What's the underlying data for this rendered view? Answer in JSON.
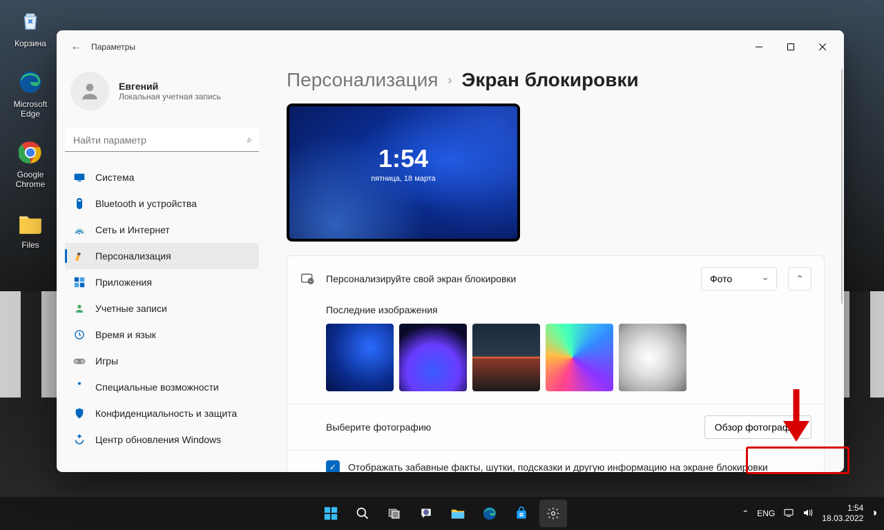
{
  "desktop_icons": [
    {
      "label": "Корзина"
    },
    {
      "label": "Microsoft Edge"
    },
    {
      "label": "Google Chrome"
    },
    {
      "label": "Files"
    }
  ],
  "window": {
    "title": "Параметры",
    "user": {
      "name": "Евгений",
      "sub": "Локальная учетная запись"
    },
    "search_placeholder": "Найти параметр",
    "nav": [
      {
        "label": "Система"
      },
      {
        "label": "Bluetooth и устройства"
      },
      {
        "label": "Сеть и Интернет"
      },
      {
        "label": "Персонализация"
      },
      {
        "label": "Приложения"
      },
      {
        "label": "Учетные записи"
      },
      {
        "label": "Время и язык"
      },
      {
        "label": "Игры"
      },
      {
        "label": "Специальные возможности"
      },
      {
        "label": "Конфиденциальность и защита"
      },
      {
        "label": "Центр обновления Windows"
      }
    ],
    "nav_active_index": 3,
    "crumbs": {
      "parent": "Персонализация",
      "current": "Экран блокировки"
    },
    "preview": {
      "time": "1:54",
      "date": "пятница, 18 марта"
    },
    "personalize": {
      "label": "Персонализируйте свой экран блокировки",
      "dropdown_value": "Фото"
    },
    "recent": {
      "title": "Последние изображения"
    },
    "choose": {
      "label": "Выберите фотографию",
      "button": "Обзор фотографий"
    },
    "funfacts": {
      "label": "Отображать забавные факты, шутки, подсказки и другую информацию на экране блокировки",
      "checked": true
    }
  },
  "taskbar": {
    "lang": "ENG",
    "time": "1:54",
    "date": "18.03.2022"
  }
}
